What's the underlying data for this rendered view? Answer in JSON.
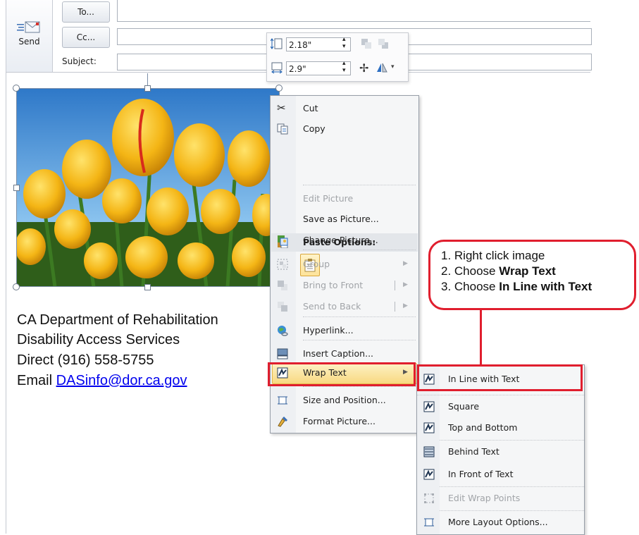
{
  "header": {
    "send_label": "Send",
    "to_label": "To...",
    "cc_label": "Cc...",
    "subject_label": "Subject:"
  },
  "mini_toolbar": {
    "height_value": "2.18\"",
    "width_value": "2.9\""
  },
  "signature": {
    "line1": "CA Department of Rehabilitation",
    "line2": "Disability Access Services",
    "line3": "Direct (916) 558-5755",
    "email_prefix": "Email ",
    "email": "DASinfo@dor.ca.gov"
  },
  "context_menu": {
    "cut": "Cut",
    "copy": "Copy",
    "paste_options": "Paste Options:",
    "edit_picture": "Edit Picture",
    "save_as_picture": "Save as Picture...",
    "change_picture": "Change Picture...",
    "group": "Group",
    "bring_to_front": "Bring to Front",
    "send_to_back": "Send to Back",
    "hyperlink": "Hyperlink...",
    "insert_caption": "Insert Caption...",
    "wrap_text": "Wrap Text",
    "size_and_position": "Size and Position...",
    "format_picture": "Format Picture..."
  },
  "wrap_submenu": {
    "in_line": "In Line with Text",
    "square": "Square",
    "top_bottom": "Top and Bottom",
    "behind": "Behind Text",
    "in_front": "In Front of Text",
    "edit_wrap_points": "Edit Wrap Points",
    "more_layout": "More Layout Options..."
  },
  "callout": {
    "step1": "1. Right click image",
    "step2_prefix": "2. Choose ",
    "step2_bold": "Wrap Text",
    "step3_prefix": "3. Choose ",
    "step3_bold": "In Line with Text"
  },
  "colors": {
    "annotation_red": "#e01e2e",
    "menu_highlight": "#f8d981",
    "link_blue": "#0000ee"
  }
}
